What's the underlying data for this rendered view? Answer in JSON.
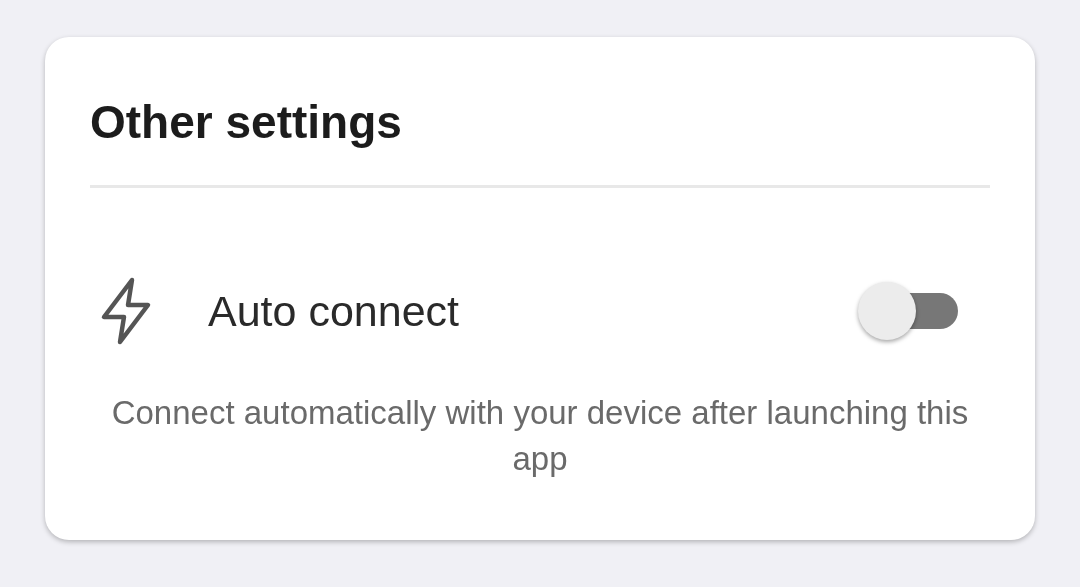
{
  "card": {
    "title": "Other settings",
    "setting": {
      "label": "Auto connect",
      "on": false,
      "description": "Connect automatically with your device after launching this app"
    }
  }
}
